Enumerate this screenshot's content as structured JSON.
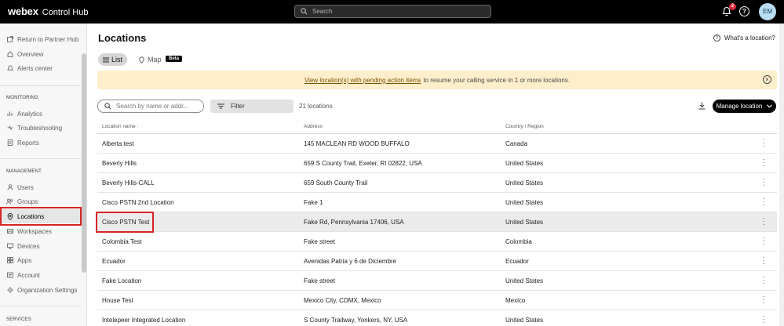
{
  "header": {
    "brand_bold": "webex",
    "brand_light": "Control Hub",
    "search_placeholder": "Search",
    "notification_count": "2",
    "help_label": "?",
    "avatar_initials": "EM"
  },
  "sidebar": {
    "top_items": [
      {
        "label": "Return to Partner Hub",
        "icon": "external-link-icon"
      },
      {
        "label": "Overview",
        "icon": "home-icon"
      },
      {
        "label": "Alerts center",
        "icon": "bell-icon"
      }
    ],
    "monitoring_heading": "MONITORING",
    "monitoring_items": [
      {
        "label": "Analytics",
        "icon": "chart-icon"
      },
      {
        "label": "Troubleshooting",
        "icon": "pulse-icon"
      },
      {
        "label": "Reports",
        "icon": "document-icon"
      }
    ],
    "management_heading": "MANAGEMENT",
    "management_items": [
      {
        "label": "Users",
        "icon": "user-icon"
      },
      {
        "label": "Groups",
        "icon": "groups-icon"
      },
      {
        "label": "Locations",
        "icon": "location-pin-icon",
        "active": true
      },
      {
        "label": "Workspaces",
        "icon": "workspace-icon"
      },
      {
        "label": "Devices",
        "icon": "device-icon"
      },
      {
        "label": "Apps",
        "icon": "apps-icon"
      },
      {
        "label": "Account",
        "icon": "account-icon"
      },
      {
        "label": "Organization Settings",
        "icon": "gear-icon"
      }
    ],
    "services_heading": "SERVICES"
  },
  "page": {
    "title": "Locations",
    "whats_link": "What's a location?",
    "tab_list": "List",
    "tab_map": "Map",
    "beta_badge": "Beta",
    "banner_link": "View location(s) with pending action items",
    "banner_text": "to resume your calling service in 1 or more locations.",
    "search_placeholder": "Search by name or addr...",
    "filter_label": "Filter",
    "count_label": "21 locations",
    "manage_label": "Manage location"
  },
  "table": {
    "columns": [
      "Location name",
      "Address",
      "Country / Region"
    ],
    "sort_indicator": "↑",
    "rows": [
      {
        "name": "Alberta test",
        "address": "145 MACLEAN RD WOOD BUFFALO",
        "country": "Canada"
      },
      {
        "name": "Beverly Hills",
        "address": "659 S County Trail, Exeter, RI 02822, USA",
        "country": "United States"
      },
      {
        "name": "Beverly Hills-CALL",
        "address": "659 South County Trail",
        "country": "United States"
      },
      {
        "name": "Cisco PSTN 2nd Location",
        "address": "Fake 1",
        "country": "United States"
      },
      {
        "name": "Cisco PSTN Test",
        "address": "Fake Rd, Pennsylvania 17406, USA",
        "country": "United States",
        "selected": true
      },
      {
        "name": "Colombia Test",
        "address": "Fake street",
        "country": "Colombia"
      },
      {
        "name": "Ecuador",
        "address": "Avenidas Patria y 6 de Diciembre",
        "country": "Ecuador"
      },
      {
        "name": "Fake Location",
        "address": "Fake street",
        "country": "United States"
      },
      {
        "name": "House Test",
        "address": "Mexico City, CDMX, Mexico",
        "country": "Mexico"
      },
      {
        "name": "Intelepeer Integrated Location",
        "address": "S County Trailway, Yonkers, NY, USA",
        "country": "United States"
      }
    ]
  },
  "colors": {
    "highlight": "#d62424",
    "banner_bg": "#feeecb",
    "topbar_bg": "#000000"
  }
}
